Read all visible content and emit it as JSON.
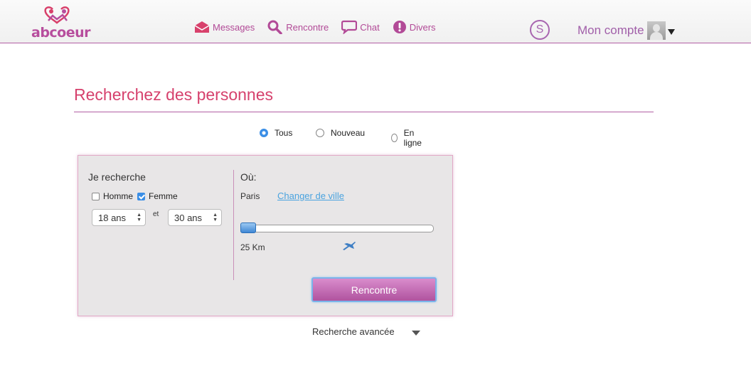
{
  "header": {
    "logo_text": "abcoeur",
    "nav": [
      {
        "label": "Messages",
        "icon": "envelope-icon"
      },
      {
        "label": "Rencontre",
        "icon": "search-icon"
      },
      {
        "label": "Chat",
        "icon": "chat-bubble-icon"
      },
      {
        "label": "Divers",
        "icon": "exclamation-icon"
      }
    ],
    "s_badge": "S",
    "account_label": "Mon compte"
  },
  "page": {
    "title": "Recherchez des personnes"
  },
  "filters": {
    "options": [
      {
        "label": "Tous",
        "selected": true
      },
      {
        "label": "Nouveau",
        "selected": false
      },
      {
        "label": "En ligne",
        "selected": false
      }
    ]
  },
  "search": {
    "looking_for_title": "Je recherche",
    "gender": [
      {
        "label": "Homme",
        "checked": false
      },
      {
        "label": "Femme",
        "checked": true
      }
    ],
    "age_min": "18 ans",
    "age_sep": "et",
    "age_max": "30 ans",
    "where_title": "Où:",
    "city": "Paris",
    "change_city": "Changer de ville",
    "distance": "25 Km",
    "submit": "Rencontre"
  },
  "advanced_label": "Recherche avancée",
  "colors": {
    "brand": "#b24a97",
    "title": "#d6416d",
    "link": "#4aa3df"
  }
}
